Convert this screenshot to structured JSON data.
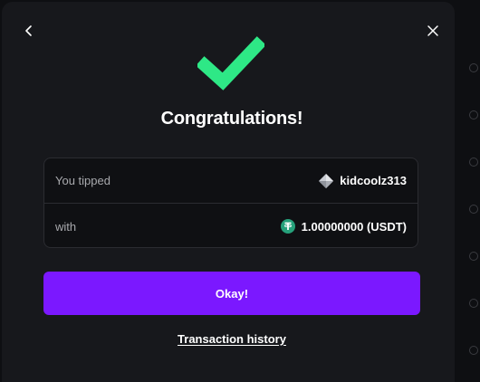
{
  "modal": {
    "title": "Congratulations!",
    "back_icon": "chevron-left-icon",
    "close_icon": "close-icon",
    "success_icon": "checkmark-icon"
  },
  "summary": {
    "tipped_label": "You tipped",
    "recipient": "kidcoolz313",
    "recipient_icon": "diamond-rank-icon",
    "with_label": "with",
    "amount": "1.00000000 (USDT)",
    "currency_icon": "usdt-tether-icon"
  },
  "actions": {
    "okay_label": "Okay!",
    "history_label": "Transaction history"
  },
  "colors": {
    "accent_purple": "#7b18ff",
    "success_green": "#2ee886",
    "usdt_green": "#26a17b",
    "modal_bg": "#17181c"
  }
}
